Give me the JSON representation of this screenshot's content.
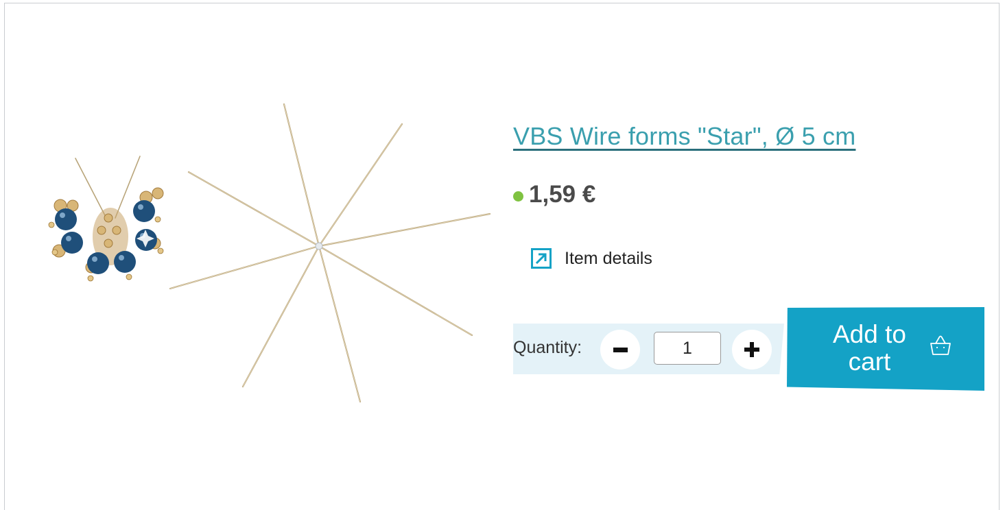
{
  "product": {
    "title": "VBS Wire forms \"Star\", Ø 5 cm",
    "price": "1,59 €",
    "availability_color": "#7fc241",
    "details_label": "Item details",
    "details_icon": "external-arrow-icon"
  },
  "purchase": {
    "quantity_label": "Quantity:",
    "quantity_value": "1",
    "minus_icon": "minus-icon",
    "plus_icon": "plus-icon",
    "add_to_cart_label": "Add to cart",
    "cart_icon": "basket-icon"
  },
  "colors": {
    "link": "#3a9fae",
    "accent": "#14a2c6",
    "quantity_band": "#e4f2f8"
  }
}
